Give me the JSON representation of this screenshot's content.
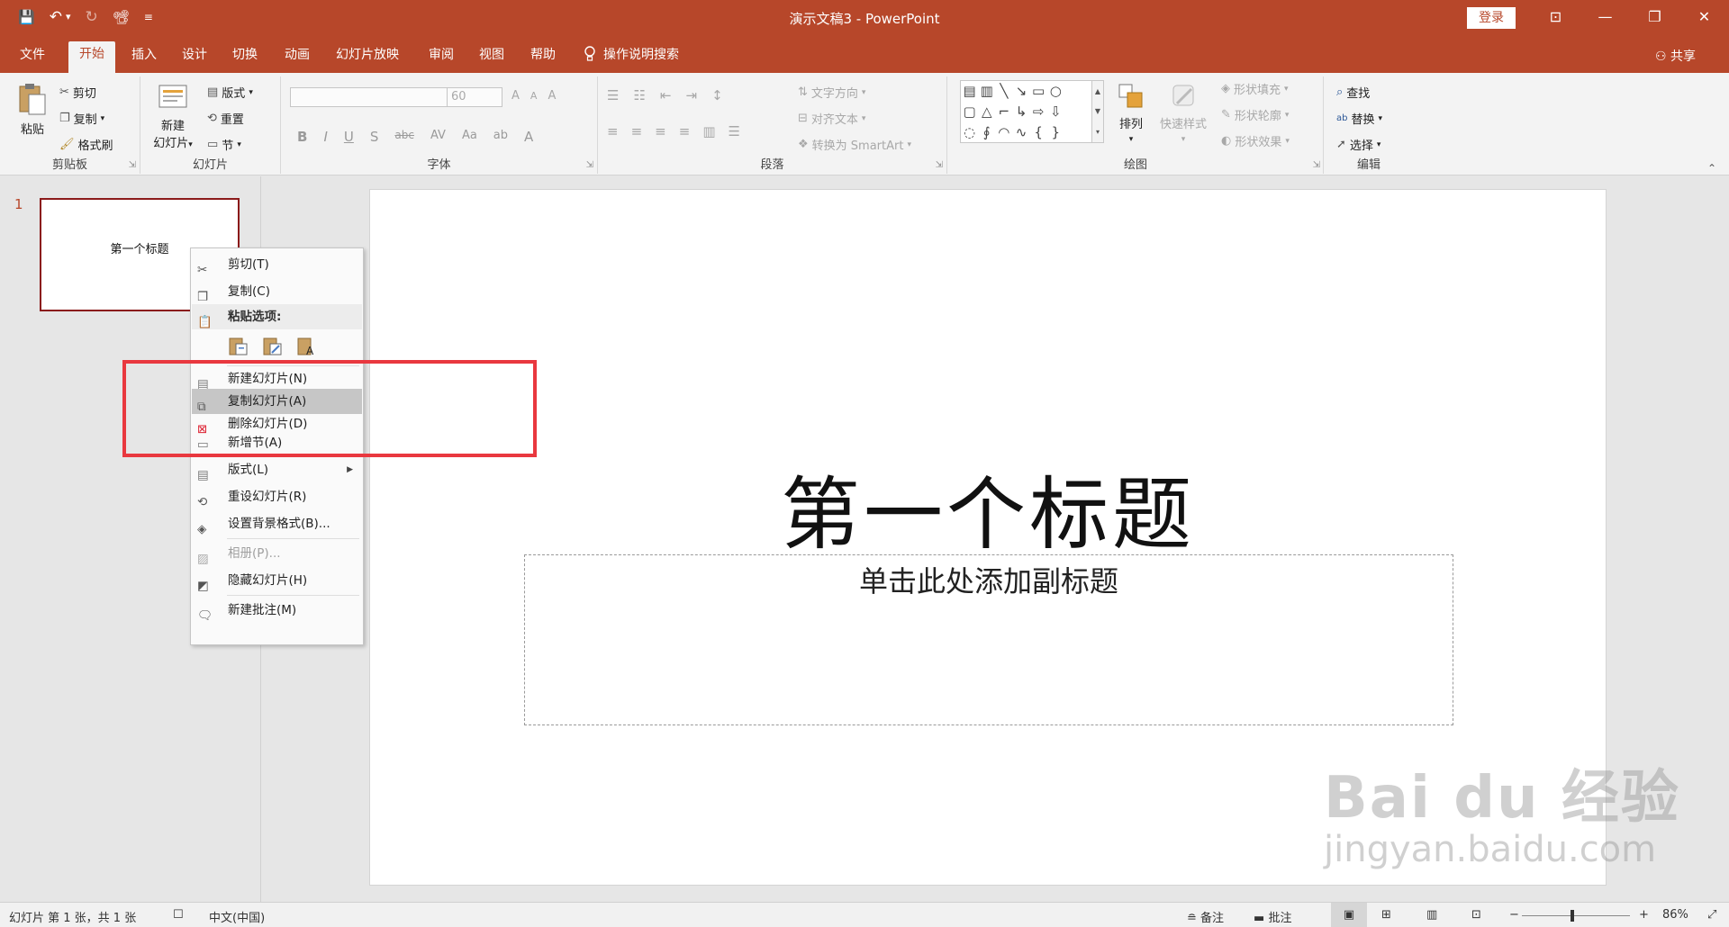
{
  "window": {
    "title": "演示文稿3  -  PowerPoint",
    "login": "登录",
    "minimize": "—",
    "restore": "❐",
    "close": "✕",
    "ribbon_display": "⊡"
  },
  "qat": {
    "save": "💾",
    "undo": "↶",
    "undo_caret": "▾",
    "redo": "↻",
    "present": "📽",
    "customize": "≡"
  },
  "tabs": [
    "文件",
    "开始",
    "插入",
    "设计",
    "切换",
    "动画",
    "幻灯片放映",
    "审阅",
    "视图",
    "帮助"
  ],
  "tell_me": "操作说明搜索",
  "share": "共享",
  "ribbon": {
    "clipboard": {
      "label": "剪贴板",
      "paste": "粘贴",
      "cut": "剪切",
      "copy": "复制",
      "format_painter": "格式刷"
    },
    "slides": {
      "label": "幻灯片",
      "new_slide": "新建",
      "new_slide2": "幻灯片",
      "layout": "版式",
      "reset": "重置",
      "section": "节"
    },
    "font": {
      "label": "字体",
      "font_name": "",
      "font_size": "60",
      "bold": "B",
      "italic": "I",
      "underline": "U",
      "shadow": "S",
      "strike": "abc",
      "spacing": "AV",
      "case": "Aa",
      "grow": "A",
      "shrink": "A",
      "clear": "A",
      "highlight": "ab",
      "color": "A"
    },
    "paragraph": {
      "label": "段落",
      "text_direction": "文字方向",
      "align_text": "对齐文本",
      "smartart": "转换为 SmartArt"
    },
    "drawing": {
      "label": "绘图",
      "arrange": "排列",
      "quick_styles": "快速样式",
      "fill": "形状填充",
      "outline": "形状轮廓",
      "effects": "形状效果"
    },
    "editing": {
      "label": "编辑",
      "find": "查找",
      "replace": "替换",
      "select": "选择"
    }
  },
  "thumbnail": {
    "number": "1",
    "title": "第一个标题"
  },
  "slide": {
    "title": "第一个标题",
    "subtitle_placeholder": "单击此处添加副标题"
  },
  "context_menu": {
    "cut": "剪切(T)",
    "copy": "复制(C)",
    "paste_options": "粘贴选项:",
    "new_slide": "新建幻灯片(N)",
    "duplicate_slide": "复制幻灯片(A)",
    "delete_slide": "删除幻灯片(D)",
    "add_section": "新增节(A)",
    "layout": "版式(L)",
    "reset_slide": "重设幻灯片(R)",
    "format_background": "设置背景格式(B)...",
    "photo_album": "相册(P)...",
    "hide_slide": "隐藏幻灯片(H)",
    "new_comment": "新建批注(M)"
  },
  "status": {
    "slide_info": "幻灯片 第 1 张，共 1 张",
    "language": "中文(中国)",
    "notes": "备注",
    "comments": "批注",
    "zoom_minus": "−",
    "zoom_plus": "+",
    "zoom": "86%"
  },
  "watermark": {
    "main": "Bai  du 经验",
    "sub": "jingyan.baidu.com"
  },
  "colors": {
    "accent": "#b7472a",
    "highlight_box": "#e9383f"
  }
}
